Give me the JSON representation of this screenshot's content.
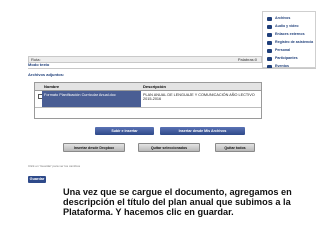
{
  "sidebar": {
    "items": [
      {
        "label": "Archivos",
        "icon": "folder-icon"
      },
      {
        "label": "Audio y video",
        "icon": "media-icon"
      },
      {
        "label": "Enlaces externos",
        "icon": "link-icon"
      },
      {
        "label": "Registro de asistencia",
        "icon": "attendance-icon"
      },
      {
        "label": "Personal",
        "icon": "person-icon"
      },
      {
        "label": "Participantes",
        "icon": "participants-icon"
      },
      {
        "label": "Eventos",
        "icon": "calendar-icon"
      }
    ]
  },
  "editor": {
    "path_label": "Ruta:",
    "words_label": "Palabras:0"
  },
  "tab_label": "Modo texto",
  "attachments_label": "Archivos adjuntos:",
  "files_table": {
    "headers": [
      "Nombre",
      "Descripción"
    ],
    "rows": [
      {
        "name": "Formato Planificación Curricular Anual.doc",
        "description": "PLAN ANUAL DE LENGUAJE Y COMUNICACIÓN AÑO LECTIVO 2015-2016"
      }
    ]
  },
  "buttons": {
    "upload": "Subir e insertar",
    "insert_file": "Insertar desde Mis Archivos",
    "insert_dropbox": "Insertar desde Dropbox",
    "remove_selected": "Quitar seleccionados",
    "remove_all": "Quitar todos"
  },
  "hint": "Click en 'Guardar' para ver los cambios",
  "save_label": "Guardar",
  "caption": "Una vez que se cargue el documento, agregamos en descripción el título del plan anual que subimos a la Plataforma. Y hacemos clic en guardar."
}
